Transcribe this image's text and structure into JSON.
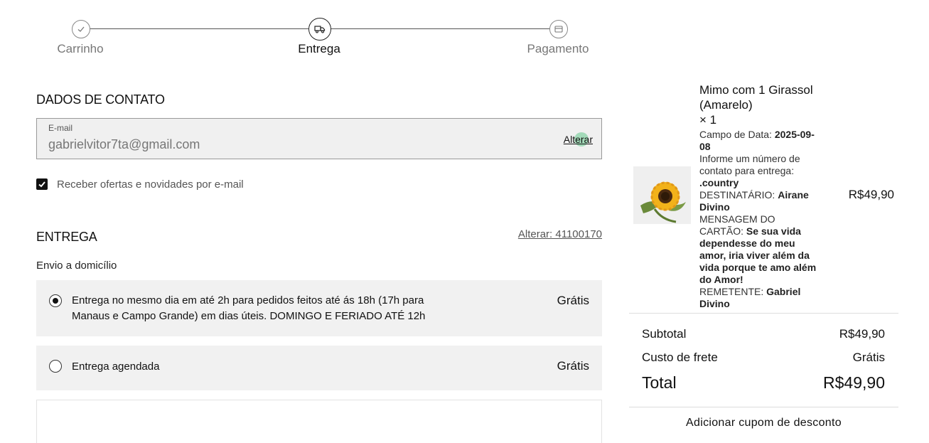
{
  "stepper": {
    "steps": [
      {
        "label": "Carrinho",
        "icon": "check-icon",
        "state": "done"
      },
      {
        "label": "Entrega",
        "icon": "truck-icon",
        "state": "active"
      },
      {
        "label": "Pagamento",
        "icon": "card-icon",
        "state": "pending"
      }
    ]
  },
  "contact": {
    "title": "DADOS DE CONTATO",
    "email_label": "E-mail",
    "email_value": "gabrielvitor7ta@gmail.com",
    "change_label": "Alterar",
    "newsletter_checked": true,
    "newsletter_label": "Receber ofertas e novidades por e-mail"
  },
  "shipping": {
    "title": "ENTREGA",
    "change_label": "Alterar: 41100170",
    "type_label": "Envio a domicílio",
    "options": [
      {
        "label": "Entrega no mesmo dia em até 2h para pedidos feitos até ás 18h (17h para Manaus e Campo Grande) em dias úteis. DOMINGO E FERIADO ATÉ 12h",
        "price": "Grátis",
        "selected": true
      },
      {
        "label": "Entrega agendada",
        "price": "Grátis",
        "selected": false
      }
    ]
  },
  "cart": {
    "product": {
      "name": "Mimo com 1 Girassol (Amarelo)",
      "qty": "× 1",
      "price": "R$49,90",
      "details": [
        {
          "key": "Campo de Data:",
          "value": "2025-09-08"
        },
        {
          "key": "Informe um número de contato para entrega:",
          "value": ".country"
        },
        {
          "key": "DESTINATÁRIO:",
          "value": "Airane Divino"
        },
        {
          "key": "MENSAGEM DO CARTÃO:",
          "value": "Se sua vida dependesse do meu amor, iria viver além da vida porque te amo além do Amor!"
        },
        {
          "key": "REMETENTE:",
          "value": "Gabriel Divino"
        }
      ]
    },
    "subtotal_label": "Subtotal",
    "subtotal_value": "R$49,90",
    "shipping_label": "Custo de frete",
    "shipping_value": "Grátis",
    "total_label": "Total",
    "total_value": "R$49,90",
    "coupon_label": "Adicionar cupom de desconto"
  }
}
